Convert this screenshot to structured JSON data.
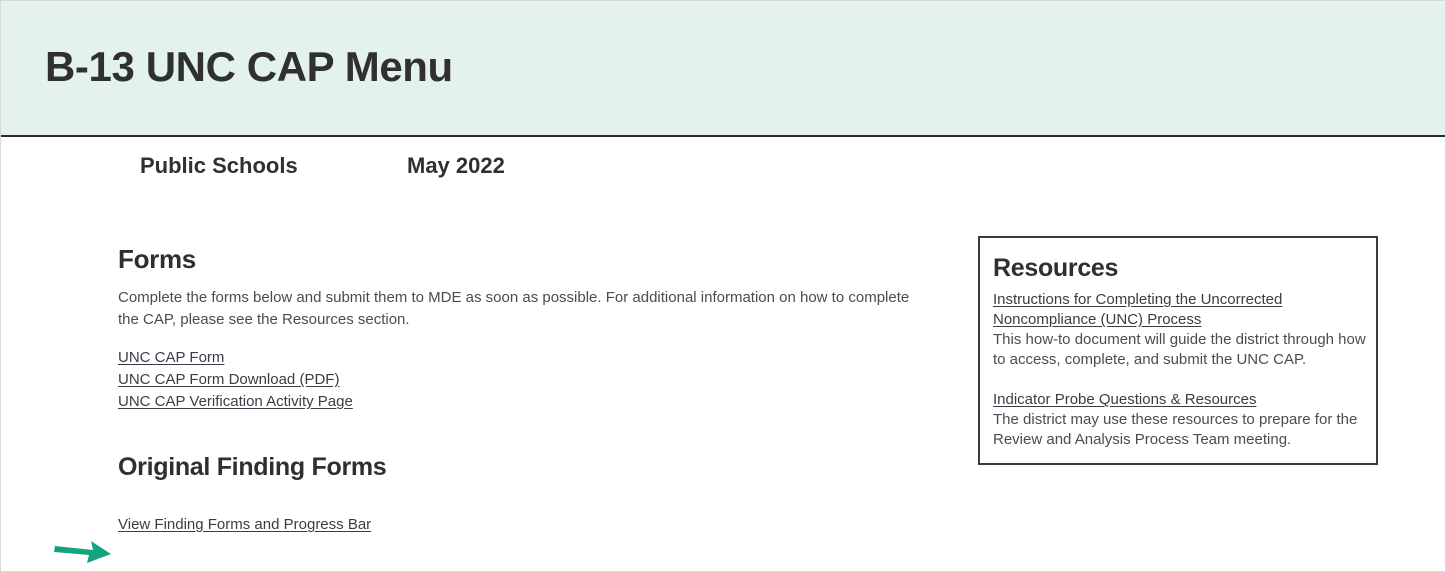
{
  "header": {
    "title": "B-13 UNC CAP Menu",
    "background_color": "#e3f2ee"
  },
  "subheader": {
    "district": "Public Schools",
    "month": "May 2022"
  },
  "forms_section": {
    "heading": "Forms",
    "intro": "Complete the forms below and submit them to MDE as soon as possible. For additional information on how to complete the CAP, please see the Resources section.",
    "links": [
      {
        "label": "UNC CAP Form"
      },
      {
        "label": "UNC CAP Form Download (PDF)"
      },
      {
        "label": "UNC CAP Verification Activity Page"
      }
    ]
  },
  "original_findings_section": {
    "heading": "Original Finding Forms",
    "links": [
      {
        "label": "View Finding Forms and Progress Bar"
      }
    ]
  },
  "resources_panel": {
    "heading": "Resources",
    "items": [
      {
        "link": "Instructions for Completing the Uncorrected Noncompliance (UNC) Process",
        "description": "This how-to document will guide the district through how to access, complete, and submit the UNC CAP."
      },
      {
        "link": "Indicator Probe Questions & Resources",
        "description": "The district may use these resources to prepare for the Review and Analysis Process Team meeting."
      }
    ]
  },
  "annotation": {
    "arrow_icon": "arrow-right-icon",
    "arrow_color": "#14a37f",
    "points_at": "UNC CAP Form"
  }
}
